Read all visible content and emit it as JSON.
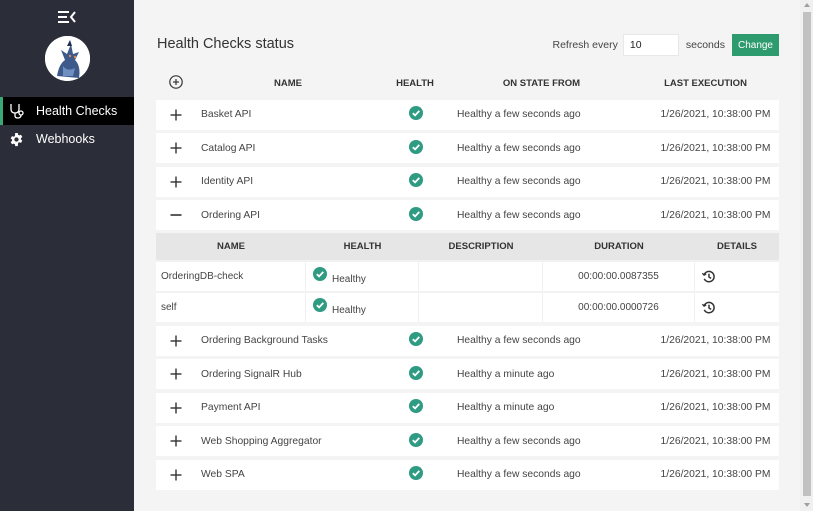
{
  "sidebar": {
    "menu_icon": "menu-collapse-icon",
    "avatar": "mascot-avatar",
    "items": [
      {
        "label": "Health Checks",
        "icon": "stethoscope-icon",
        "active": true
      },
      {
        "label": "Webhooks",
        "icon": "gear-icon",
        "active": false
      }
    ]
  },
  "header": {
    "title": "Health Checks status",
    "refresh_label": "Refresh every",
    "refresh_value": "10",
    "seconds_label": "seconds",
    "change_button": "Change"
  },
  "colors": {
    "accent": "#2e9b6e",
    "healthy": "#2e9b82",
    "sidebar_bg": "#2b2e38"
  },
  "table": {
    "expand_all_icon": "circle-plus-icon",
    "columns": [
      "NAME",
      "HEALTH",
      "ON STATE FROM",
      "LAST EXECUTION"
    ],
    "rows": [
      {
        "name": "Basket API",
        "health": "healthy",
        "state": "Healthy a few seconds ago",
        "last": "1/26/2021, 10:38:00 PM",
        "expanded": false
      },
      {
        "name": "Catalog API",
        "health": "healthy",
        "state": "Healthy a few seconds ago",
        "last": "1/26/2021, 10:38:00 PM",
        "expanded": false
      },
      {
        "name": "Identity API",
        "health": "healthy",
        "state": "Healthy a few seconds ago",
        "last": "1/26/2021, 10:38:00 PM",
        "expanded": false
      },
      {
        "name": "Ordering API",
        "health": "healthy",
        "state": "Healthy a few seconds ago",
        "last": "1/26/2021, 10:38:00 PM",
        "expanded": true
      },
      {
        "name": "Ordering Background Tasks",
        "health": "healthy",
        "state": "Healthy a few seconds ago",
        "last": "1/26/2021, 10:38:00 PM",
        "expanded": false
      },
      {
        "name": "Ordering SignalR Hub",
        "health": "healthy",
        "state": "Healthy a minute ago",
        "last": "1/26/2021, 10:38:00 PM",
        "expanded": false
      },
      {
        "name": "Payment API",
        "health": "healthy",
        "state": "Healthy a minute ago",
        "last": "1/26/2021, 10:38:00 PM",
        "expanded": false
      },
      {
        "name": "Web Shopping Aggregator",
        "health": "healthy",
        "state": "Healthy a few seconds ago",
        "last": "1/26/2021, 10:38:00 PM",
        "expanded": false
      },
      {
        "name": "Web SPA",
        "health": "healthy",
        "state": "Healthy a few seconds ago",
        "last": "1/26/2021, 10:38:00 PM",
        "expanded": false
      }
    ],
    "detail": {
      "columns": [
        "NAME",
        "HEALTH",
        "DESCRIPTION",
        "DURATION",
        "DETAILS"
      ],
      "rows": [
        {
          "name": "OrderingDB-check",
          "health": "Healthy",
          "description": "",
          "duration": "00:00:00.0087355",
          "details_icon": "history-icon"
        },
        {
          "name": "self",
          "health": "Healthy",
          "description": "",
          "duration": "00:00:00.0000726",
          "details_icon": "history-icon"
        }
      ]
    }
  }
}
